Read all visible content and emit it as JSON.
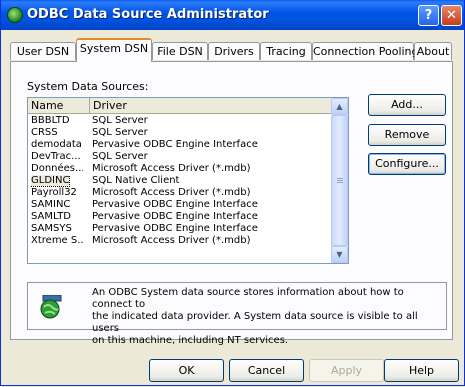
{
  "window": {
    "title": "ODBC Data Source Administrator",
    "help_label": "?",
    "close_label": "✕"
  },
  "tabs": [
    {
      "label": "User DSN",
      "active": false
    },
    {
      "label": "System DSN",
      "active": true
    },
    {
      "label": "File DSN",
      "active": false
    },
    {
      "label": "Drivers",
      "active": false
    },
    {
      "label": "Tracing",
      "active": false
    },
    {
      "label": "Connection Pooling",
      "active": false
    },
    {
      "label": "About",
      "active": false
    }
  ],
  "system_data_sources": {
    "label": "System Data Sources:",
    "columns": {
      "name": "Name",
      "driver": "Driver"
    },
    "rows": [
      {
        "name": "BBBLTD",
        "driver": "SQL Server",
        "selected": false
      },
      {
        "name": "CRSS",
        "driver": "SQL Server",
        "selected": false
      },
      {
        "name": "demodata",
        "driver": "Pervasive ODBC Engine Interface",
        "selected": false
      },
      {
        "name": "DevTrac...",
        "driver": "SQL Server",
        "selected": false
      },
      {
        "name": "Données...",
        "driver": "Microsoft Access Driver (*.mdb)",
        "selected": false
      },
      {
        "name": "GLDINC",
        "driver": "SQL Native Client",
        "selected": true
      },
      {
        "name": "Payroll32",
        "driver": "Microsoft Access Driver (*.mdb)",
        "selected": false
      },
      {
        "name": "SAMINC",
        "driver": "Pervasive ODBC Engine Interface",
        "selected": false
      },
      {
        "name": "SAMLTD",
        "driver": "Pervasive ODBC Engine Interface",
        "selected": false
      },
      {
        "name": "SAMSYS",
        "driver": "Pervasive ODBC Engine Interface",
        "selected": false
      },
      {
        "name": "Xtreme S...",
        "driver": "Microsoft Access Driver (*.mdb)",
        "selected": false
      }
    ]
  },
  "side_buttons": {
    "add": "Add...",
    "remove": "Remove",
    "configure": "Configure..."
  },
  "info": {
    "line1": "An ODBC System data source stores information about how to connect to",
    "line2": "the indicated data provider.   A System data source is visible to all users",
    "line3": "on this machine, including NT services."
  },
  "bottom_buttons": {
    "ok": "OK",
    "cancel": "Cancel",
    "apply": "Apply",
    "help": "Help"
  }
}
